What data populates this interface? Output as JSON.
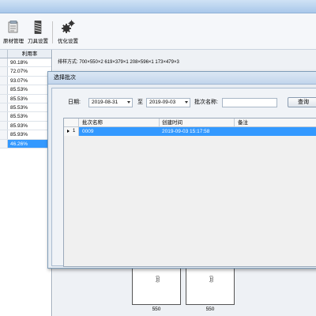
{
  "toolbar": {
    "buttons": [
      {
        "label": "原材管理",
        "icon": "material-icon"
      },
      {
        "label": "刀具设置",
        "icon": "blade-icon"
      },
      {
        "label": "优化设置",
        "icon": "gears-icon"
      }
    ]
  },
  "left_panel": {
    "header": "利用率",
    "rows": [
      "90.18%",
      "72.07%",
      "93.07%",
      "85.53%",
      "85.53%",
      "85.53%",
      "85.53%",
      "85.93%",
      "85.93%",
      "46.26%"
    ],
    "selected_index": 9
  },
  "layout_info": "排样方式: 700×550×2  619×379×1  208×596×1  173×479×3",
  "plates": {
    "dims": [
      "550",
      "550"
    ],
    "inner_labels": [
      "(11)",
      "(11)"
    ]
  },
  "dialog": {
    "title": "选择批次",
    "date_label": "日期:",
    "date_from": "2019-08-31",
    "to_label": "至",
    "date_to": "2019-09-03",
    "batch_label": "批次名称:",
    "batch_value": "",
    "query_button": "查询",
    "grid": {
      "columns": [
        "批次名称",
        "创建时间",
        "备注"
      ],
      "rows": [
        {
          "index": "1",
          "name": "0009",
          "created": "2019-09-03 15:17:58",
          "note": ""
        }
      ]
    }
  },
  "colors": {
    "selection": "#3399ff",
    "toolbar_bg": "#f5f7fa",
    "dialog_bg": "#e8edf3"
  }
}
